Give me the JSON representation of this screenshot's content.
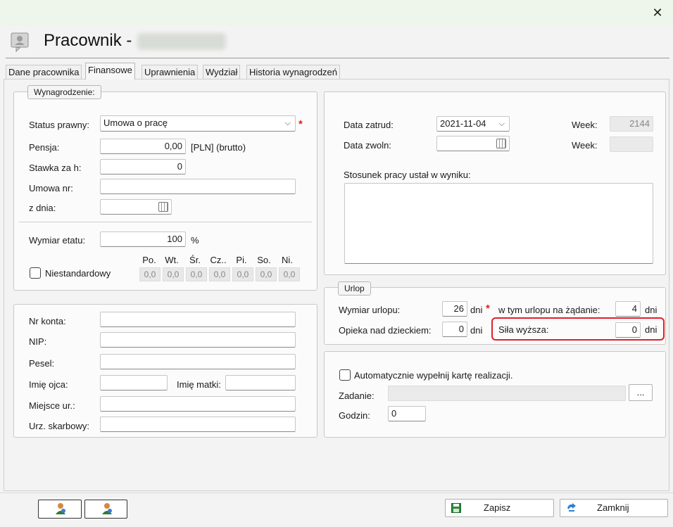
{
  "window": {
    "close_icon": "close-icon",
    "title_prefix": "Pracownik -"
  },
  "tabs": [
    {
      "label": "Dane pracownika"
    },
    {
      "label": "Finansowe"
    },
    {
      "label": "Uprawnienia"
    },
    {
      "label": "Wydział"
    },
    {
      "label": "Historia wynagrodzeń"
    }
  ],
  "salary": {
    "legend": "Wynagrodzenie:",
    "status_label": "Status prawny:",
    "status_value": "Umowa o pracę",
    "required_mark": "*",
    "pensja_label": "Pensja:",
    "pensja_value": "0,00",
    "pensja_unit": "[PLN] (brutto)",
    "stawka_label": "Stawka za h:",
    "stawka_value": "0",
    "umowa_label": "Umowa nr:",
    "umowa_value": "",
    "zdnia_label": "z dnia:",
    "zdnia_value": "",
    "wymiar_label": "Wymiar etatu:",
    "wymiar_value": "100",
    "wymiar_unit": "%",
    "niestd_label": "Niestandardowy",
    "days": [
      {
        "label": "Po.",
        "value": "0,0"
      },
      {
        "label": "Wt.",
        "value": "0,0"
      },
      {
        "label": "Śr.",
        "value": "0,0"
      },
      {
        "label": "Cz..",
        "value": "0,0"
      },
      {
        "label": "Pi.",
        "value": "0,0"
      },
      {
        "label": "So.",
        "value": "0,0"
      },
      {
        "label": "Ni.",
        "value": "0,0"
      }
    ]
  },
  "employment": {
    "data_zatrud_label": "Data zatrud:",
    "data_zatrud_value": "2021-11-04",
    "data_zwoln_label": "Data zwoln:",
    "data_zwoln_value": "",
    "week_label": "Week:",
    "week1_value": "2144",
    "week2_value": "",
    "stosunek_label": "Stosunek pracy ustał w wyniku:",
    "stosunek_value": ""
  },
  "personal": {
    "nr_konta_label": "Nr konta:",
    "nip_label": "NIP:",
    "pesel_label": "Pesel:",
    "imie_ojca_label": "Imię ojca:",
    "imie_matki_label": "Imię matki:",
    "miejsce_label": "Miejsce ur.:",
    "urz_label": "Urz. skarbowy:",
    "nr_konta_value": "",
    "nip_value": "",
    "pesel_value": "",
    "imie_ojca_value": "",
    "imie_matki_value": "",
    "miejsce_value": "",
    "urz_value": ""
  },
  "urlop": {
    "legend": "Urlop",
    "wymiar_label": "Wymiar urlopu:",
    "wymiar_value": "26",
    "dni": "dni",
    "required_mark": "*",
    "zadanie_label": "w tym urlopu na żądanie:",
    "zadanie_value": "4",
    "opieka_label": "Opieka nad dzieckiem:",
    "opieka_value": "0",
    "sila_label": "Siła wyższa:",
    "sila_value": "0"
  },
  "realizacja": {
    "auto_label": "Automatycznie wypełnij kartę realizacji.",
    "zadanie_label": "Zadanie:",
    "zadanie_value": "",
    "browse_label": "...",
    "godzin_label": "Godzin:",
    "godzin_value": "0"
  },
  "footer": {
    "save_label": "Zapisz",
    "close_label": "Zamknij"
  },
  "colors": {
    "titlebar": "#eef5ea",
    "highlight": "#e0202a",
    "required": "#e02020"
  }
}
